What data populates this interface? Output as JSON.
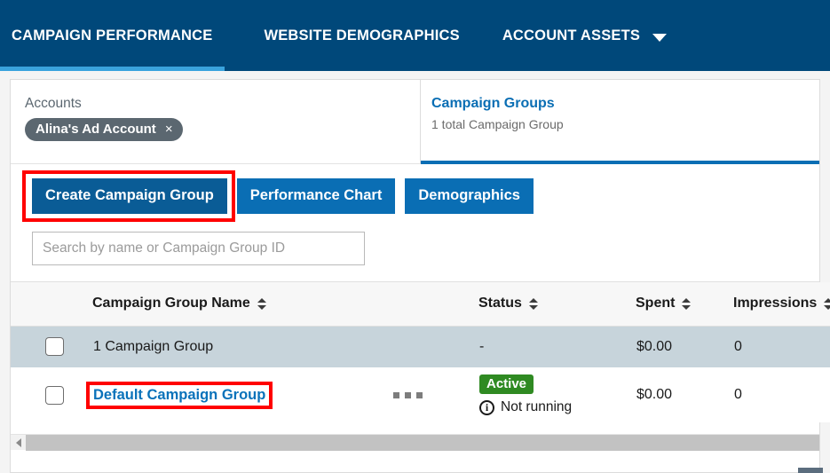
{
  "topnav": {
    "tabs": [
      {
        "label": "CAMPAIGN PERFORMANCE",
        "active": true
      },
      {
        "label": "WEBSITE DEMOGRAPHICS",
        "active": false
      },
      {
        "label": "ACCOUNT ASSETS",
        "active": false,
        "caret": "chevron-down-icon"
      }
    ],
    "background_color": "#00487a",
    "active_underline_color": "#3aa3dd"
  },
  "selector": {
    "accounts": {
      "label": "Accounts",
      "chip": {
        "text": "Alina's Ad Account",
        "remove": "×",
        "color": "#5b6770"
      }
    },
    "campaign_groups": {
      "title": "Campaign Groups",
      "subtitle": "1 total Campaign Group",
      "accent_color": "#0a6eb4"
    }
  },
  "actions": {
    "create": "Create Campaign Group",
    "performance_chart": "Performance Chart",
    "demographics": "Demographics"
  },
  "search": {
    "placeholder": "Search by name or Campaign Group ID",
    "value": ""
  },
  "table": {
    "headers": {
      "name": "Campaign Group Name",
      "status": "Status",
      "spent": "Spent",
      "impressions": "Impressions"
    },
    "summary_row": {
      "name": "1 Campaign Group",
      "status": "-",
      "spent": "$0.00",
      "impressions": "0"
    },
    "rows": [
      {
        "name": "Default Campaign Group",
        "status_badge": "Active",
        "status_note": "Not running",
        "spent": "$0.00",
        "impressions": "0",
        "badge_color": "#2f8a22",
        "highlighted": true
      }
    ]
  },
  "annotations": {
    "highlight_color": "#ff0000",
    "targets": [
      "create-campaign-group-button",
      "default-campaign-group-link"
    ]
  }
}
